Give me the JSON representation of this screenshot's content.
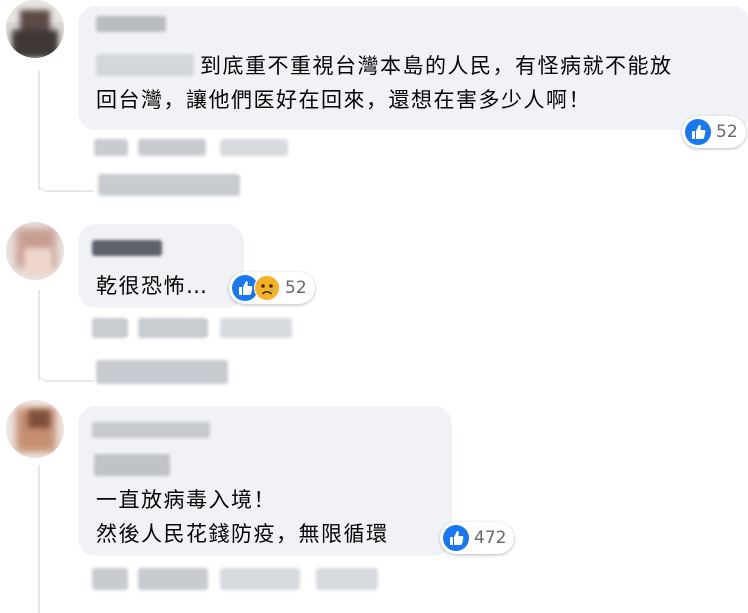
{
  "comments": [
    {
      "text_line1": "到底重不重視台灣本島的人民，有怪病就不能放",
      "text_line2": "回台灣，讓他們医好在回來，還想在害多少人啊！",
      "reaction_count": "52",
      "reactions": [
        "like-icon"
      ]
    },
    {
      "text_line1": "乾很恐怖…",
      "reaction_count": "52",
      "reactions": [
        "like-icon",
        "care-icon"
      ]
    },
    {
      "text_line1": "一直放病毒入境！",
      "text_line2": "然後人民花錢防疫，無限循環",
      "reaction_count": "472",
      "reactions": [
        "like-icon"
      ]
    }
  ],
  "colors": {
    "bubble": "#f0f2f5",
    "like_blue": "#1877f2",
    "count_gray": "#65676b",
    "care_yellow": "#f7b125"
  }
}
